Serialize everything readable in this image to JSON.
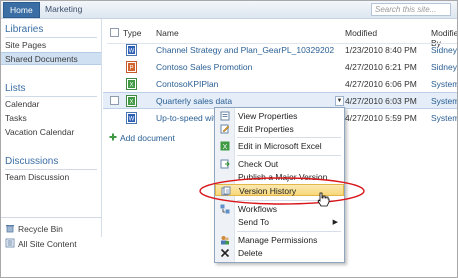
{
  "topbar": {
    "tabs": [
      "Home",
      "Marketing"
    ],
    "search_placeholder": "Search this site..."
  },
  "leftnav": {
    "libraries_heading": "Libraries",
    "libraries": [
      "Site Pages",
      "Shared Documents"
    ],
    "lists_heading": "Lists",
    "lists": [
      "Calendar",
      "Tasks",
      "Vacation Calendar"
    ],
    "discussions_heading": "Discussions",
    "discussions": [
      "Team Discussion"
    ],
    "recycle_bin": "Recycle Bin",
    "all_site_content": "All Site Content"
  },
  "list": {
    "col_type": "Type",
    "col_name": "Name",
    "col_modified": "Modified",
    "col_modified_by": "Modified By",
    "rows": [
      {
        "name": "Channel Strategy and Plan_GearPL_10329202",
        "modified": "1/23/2010 8:40 PM",
        "by": "Sidney",
        "icon": "word-document-icon"
      },
      {
        "name": "Contoso Sales Promotion",
        "modified": "4/27/2010 6:21 PM",
        "by": "Sidney",
        "icon": "powerpoint-document-icon"
      },
      {
        "name": "ContosoKPIPlan",
        "modified": "4/27/2010 6:06 PM",
        "by": "System",
        "icon": "excel-document-icon"
      },
      {
        "name": "Quarterly sales data",
        "modified": "4/27/2010 6:03 PM",
        "by": "System",
        "icon": "excel-document-icon"
      },
      {
        "name": "Up-to-speed wit",
        "modified": "4/27/2010 5:59 PM",
        "by": "System",
        "icon": "word-document-icon"
      }
    ],
    "add_document": "Add document"
  },
  "context_menu": {
    "items": [
      "View Properties",
      "Edit Properties",
      "Edit in Microsoft Excel",
      "Check Out",
      "Publish a Major Version",
      "Version History",
      "Workflows",
      "Send To",
      "Manage Permissions",
      "Delete"
    ],
    "highlighted": "Version History"
  },
  "colors": {
    "accent": "#3a6ea5",
    "link": "#2a5f94",
    "annotation": "#d9161a",
    "menu_highlight": "#f7d779"
  }
}
